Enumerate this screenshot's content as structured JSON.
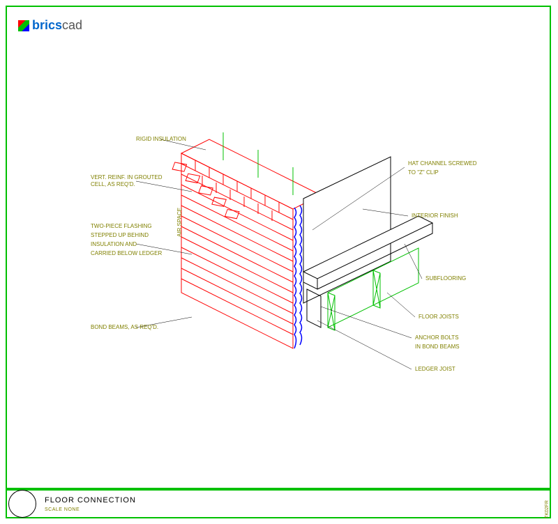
{
  "app": {
    "logo_part1": "brics",
    "logo_part2": "cad"
  },
  "labels": {
    "rigid_insulation": "RIGID INSULATION",
    "vert_reinf": "VERT. REINF. IN GROUTED\nCELL, AS REQ'D.",
    "two_piece_flashing_1": "TWO-PIECE FLASHING",
    "two_piece_flashing_2": "STEPPED UP BEHIND",
    "two_piece_flashing_3": "INSULATION AND",
    "two_piece_flashing_4": "CARRIED BELOW LEDGER",
    "bond_beams": "BOND BEAMS, AS REQ'D.",
    "hat_channel_1": "HAT CHANNEL SCREWED",
    "hat_channel_2": "TO \"Z\" CLIP",
    "interior_finish": "INTERIOR FINISH",
    "subflooring": "SUBFLOORING",
    "floor_joists": "FLOOR JOISTS",
    "anchor_bolts_1": "ANCHOR BOLTS",
    "anchor_bolts_2": "IN BOND BEAMS",
    "ledger_joist": "LEDGER JOIST",
    "air_space": "AIR SPACE"
  },
  "footer": {
    "title": "FLOOR CONNECTION",
    "scale": "SCALE NONE",
    "side_ref": "TK02FR"
  }
}
